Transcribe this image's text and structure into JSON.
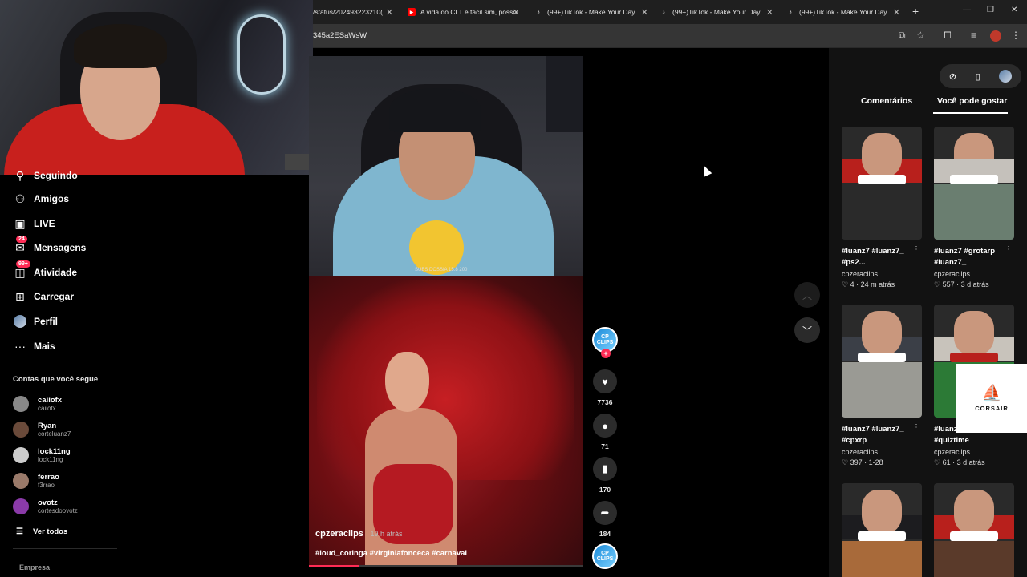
{
  "browser": {
    "tabs": [
      {
        "label": "/status/202493223210(",
        "icon": "x-icon"
      },
      {
        "label": "A vida do CLT é fácil sim, posso",
        "icon": "youtube-icon"
      },
      {
        "label": "(99+)TikTok - Make Your Day",
        "icon": "tiktok-icon"
      },
      {
        "label": "(99+)TikTok - Make Your Day",
        "icon": "tiktok-icon"
      },
      {
        "label": "(99+)TikTok - Make Your Day",
        "icon": "tiktok-icon"
      }
    ],
    "url": "345a2ESaWsW"
  },
  "sidebar": {
    "partial_label": "Seguindo",
    "items": [
      {
        "label": "Amigos",
        "icon": "friends-icon"
      },
      {
        "label": "LIVE",
        "icon": "live-icon"
      },
      {
        "label": "Mensagens",
        "icon": "messages-icon",
        "badge": "24"
      },
      {
        "label": "Atividade",
        "icon": "activity-icon",
        "badge": "99+"
      },
      {
        "label": "Carregar",
        "icon": "upload-icon"
      },
      {
        "label": "Perfil",
        "icon": "profile-icon"
      },
      {
        "label": "Mais",
        "icon": "more-icon"
      }
    ],
    "following_title": "Contas que você segue",
    "accounts": [
      {
        "name": "caiiofx",
        "user": "caiiofx",
        "color": "#888888"
      },
      {
        "name": "Ryan",
        "user": "corteluanz7",
        "color": "#6a4a3a"
      },
      {
        "name": "lock11ng",
        "user": "lock11ng",
        "color": "#cccccc"
      },
      {
        "name": "ferrao",
        "user": "f3rrao",
        "color": "#9a7a6a"
      },
      {
        "name": "ovotz",
        "user": "cortesdoovotz",
        "color": "#8a3aa8"
      }
    ],
    "see_all": "Ver todos",
    "footer": "Empresa"
  },
  "video": {
    "overlay_text": "SUBS DOSSIA 15.8 200",
    "author": "cpzeraclips",
    "time_ago": "· 19 h atrás",
    "tags": "#loud_coringa #virginiafonceca #carnaval",
    "progress": 0.18
  },
  "actions": {
    "creator_avatar": "CP CLIPS",
    "likes": "7736",
    "comments": "71",
    "saves": "170",
    "shares": "184"
  },
  "right_panel": {
    "tabs": [
      "Comentários",
      "Você pode gostar"
    ],
    "active_tab": 1,
    "cards": [
      {
        "title": "#luanz7 #luanz7_ #ps2...",
        "author": "cpzeraclips",
        "likes": "4",
        "time": "24 m atrás"
      },
      {
        "title": "#luanz7 #grotarp #luanz7_",
        "author": "cpzeraclips",
        "likes": "557",
        "time": "3 d atrás"
      },
      {
        "title": "#luanz7 #luanz7_ #cpxrp",
        "author": "cpzeraclips",
        "likes": "397",
        "time": "1-28"
      },
      {
        "title": "#luanz #quiz #quiztime",
        "author": "cpzeraclips",
        "likes": "61",
        "time": "3 d atrás"
      }
    ],
    "sponsor": "CORSAIR"
  },
  "colors": {
    "accent": "#fe2c55",
    "background": "#000000",
    "panel": "#121212"
  }
}
